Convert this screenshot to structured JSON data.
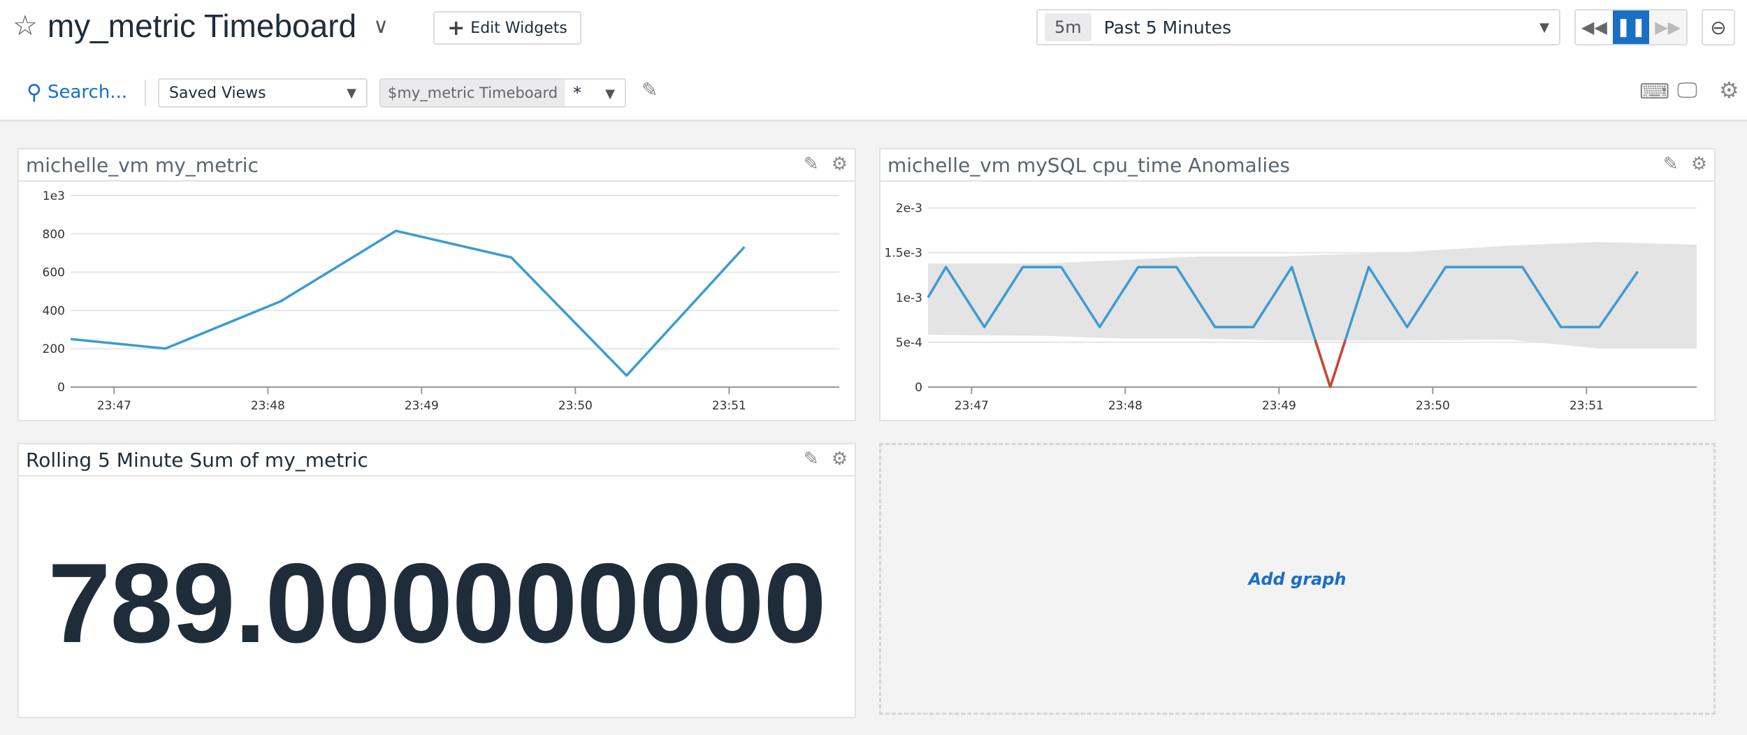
{
  "header": {
    "title": "my_metric Timeboard",
    "edit_widgets": "Edit Widgets",
    "time_badge": "5m",
    "time_label": "Past 5 Minutes",
    "search": "Search...",
    "saved_views": "Saved Views",
    "template_var_name": "$my_metric Timeboard",
    "template_var_value": "*",
    "icons": [
      "star-icon",
      "chevron-down-icon",
      "plus-icon",
      "rewind-icon",
      "pause-icon",
      "fast-forward-icon",
      "zoom-out-icon",
      "search-icon",
      "pencil-icon",
      "keyboard-icon",
      "monitor-icon",
      "gear-icon"
    ],
    "accent": "#1a6fc4"
  },
  "widgets": {
    "w1": {
      "title": "michelle_vm my_metric"
    },
    "w2": {
      "title": "michelle_vm mySQL cpu_time Anomalies"
    },
    "w3": {
      "title": "Rolling 5 Minute Sum of my_metric",
      "value": "789.000000000"
    },
    "add_graph": "Add graph"
  },
  "chart_data": [
    {
      "type": "line",
      "xlim": [
        "23:46:43",
        "23:51:43"
      ],
      "ylim": [
        0,
        1000
      ],
      "yticks": [
        0,
        200,
        400,
        600,
        800,
        1000
      ],
      "ytick_labels": [
        "0",
        "200",
        "400",
        "600",
        "800",
        "1e3"
      ],
      "xticks": [
        "23:47",
        "23:48",
        "23:49",
        "23:50",
        "23:51"
      ],
      "grid": true,
      "color": "#3d9bd1",
      "series": [
        {
          "x": [
            "23:46:43",
            "23:47:20",
            "23:48:05",
            "23:48:50",
            "23:49:35",
            "23:50:20",
            "23:51:06"
          ],
          "values": [
            251,
            201,
            448,
            816,
            677,
            60,
            732
          ]
        }
      ]
    },
    {
      "type": "line",
      "xlim": [
        "23:46:43",
        "23:51:43"
      ],
      "ylim": [
        0,
        0.0022
      ],
      "yticks": [
        0,
        0.0005,
        0.001,
        0.0015,
        0.002
      ],
      "ytick_labels": [
        "0",
        "5e-4",
        "1e-3",
        "1.5e-3",
        "2e-3"
      ],
      "xticks": [
        "23:47",
        "23:48",
        "23:49",
        "23:50",
        "23:51"
      ],
      "grid": true,
      "color": "#3d9bd1",
      "anomaly_color": "#d0452a",
      "band_color": "#e4e4e4",
      "series": [
        {
          "x": [
            "23:46:43",
            "23:46:50",
            "23:47:05",
            "23:47:20",
            "23:47:35",
            "23:47:50",
            "23:48:05",
            "23:48:20",
            "23:48:35",
            "23:48:50",
            "23:49:05",
            "23:49:20",
            "23:49:35",
            "23:49:50",
            "23:50:05",
            "23:50:20",
            "23:50:35",
            "23:50:50",
            "23:51:05",
            "23:51:20"
          ],
          "values": [
            0.001,
            0.00134,
            0.00067,
            0.00134,
            0.00134,
            0.00067,
            0.00134,
            0.00134,
            0.00067,
            0.00067,
            0.00134,
            0,
            0.00134,
            0.00067,
            0.00134,
            0.00134,
            0.00134,
            0.00067,
            0.00067,
            0.00129
          ]
        }
      ],
      "band": {
        "x": [
          "23:46:43",
          "23:47:30",
          "23:48:00",
          "23:48:30",
          "23:49:00",
          "23:49:45",
          "23:50:30",
          "23:51:05",
          "23:51:43"
        ],
        "upper": [
          0.00138,
          0.00138,
          0.00142,
          0.00146,
          0.00146,
          0.0015,
          0.00158,
          0.00162,
          0.00159
        ],
        "lower": [
          0.000584,
          0.00057,
          0.00054,
          0.00054,
          0.00052,
          0.00052,
          0.00053,
          0.00043,
          0.00043
        ]
      }
    }
  ]
}
